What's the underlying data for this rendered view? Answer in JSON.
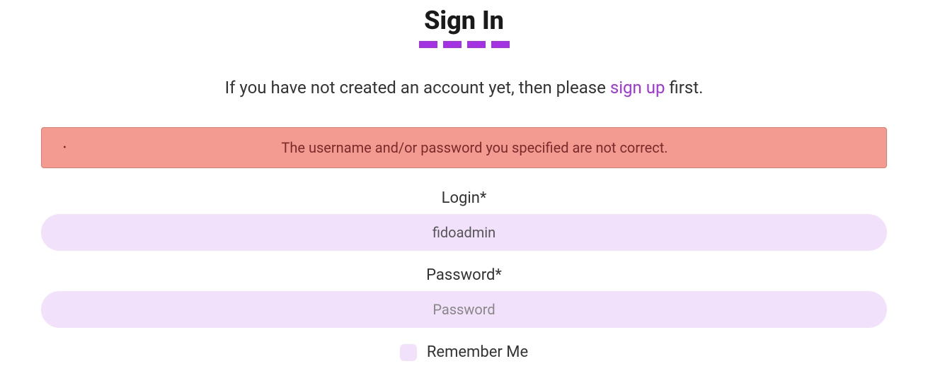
{
  "title": "Sign In",
  "subtitle": {
    "prefix": "If you have not created an account yet, then please ",
    "link": "sign up",
    "suffix": " first."
  },
  "error": {
    "message": "The username and/or password you specified are not correct."
  },
  "form": {
    "login": {
      "label": "Login*",
      "value": "fidoadmin"
    },
    "password": {
      "label": "Password*",
      "placeholder": "Password",
      "value": ""
    },
    "remember": {
      "label": "Remember Me",
      "checked": false
    }
  }
}
